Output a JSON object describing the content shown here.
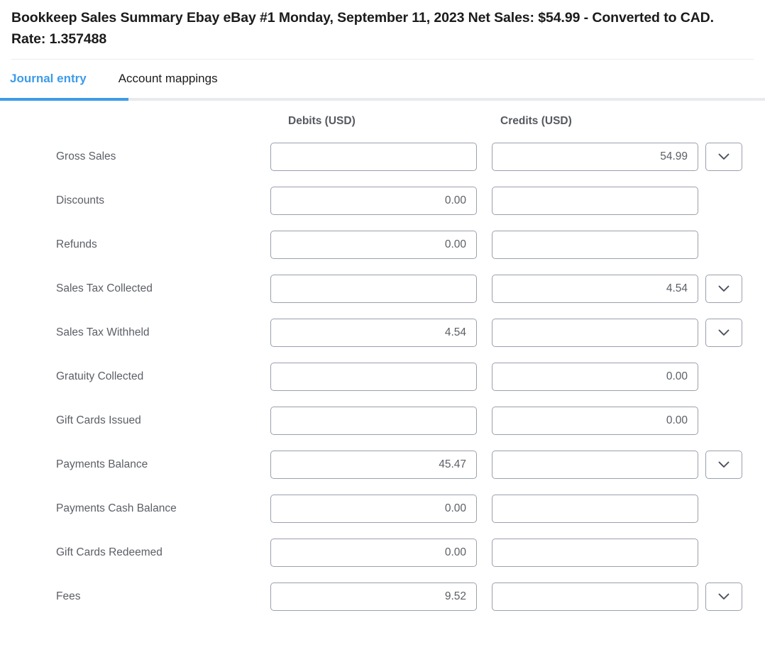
{
  "header": {
    "title": "Bookkeep Sales Summary Ebay eBay #1 Monday, September 11, 2023 Net Sales: $54.99 - Converted to CAD. Rate: 1.357488"
  },
  "tabs": [
    {
      "label": "Journal entry",
      "active": true
    },
    {
      "label": "Account mappings",
      "active": false
    }
  ],
  "columns": {
    "label": "",
    "debits": "Debits (USD)",
    "credits": "Credits (USD)"
  },
  "colors": {
    "accent": "#3d9be9",
    "label_text": "#5c5f66",
    "header_text": "#56595e",
    "title_text": "#1b1b1b",
    "input_border": "#9aa0ac",
    "divider": "#e8eaed",
    "background": "#ffffff"
  },
  "icons": {
    "chevron": "chevron-down-icon"
  },
  "rows": [
    {
      "label": "Gross Sales",
      "debit": "",
      "credit": "54.99",
      "chevron": true
    },
    {
      "label": "Discounts",
      "debit": "0.00",
      "credit": "",
      "chevron": false
    },
    {
      "label": "Refunds",
      "debit": "0.00",
      "credit": "",
      "chevron": false
    },
    {
      "label": "Sales Tax Collected",
      "debit": "",
      "credit": "4.54",
      "chevron": true
    },
    {
      "label": "Sales Tax Withheld",
      "debit": "4.54",
      "credit": "",
      "chevron": true
    },
    {
      "label": "Gratuity Collected",
      "debit": "",
      "credit": "0.00",
      "chevron": false
    },
    {
      "label": "Gift Cards Issued",
      "debit": "",
      "credit": "0.00",
      "chevron": false
    },
    {
      "label": "Payments Balance",
      "debit": "45.47",
      "credit": "",
      "chevron": true
    },
    {
      "label": "Payments Cash Balance",
      "debit": "0.00",
      "credit": "",
      "chevron": false
    },
    {
      "label": "Gift Cards Redeemed",
      "debit": "0.00",
      "credit": "",
      "chevron": false
    },
    {
      "label": "Fees",
      "debit": "9.52",
      "credit": "",
      "chevron": true
    }
  ]
}
